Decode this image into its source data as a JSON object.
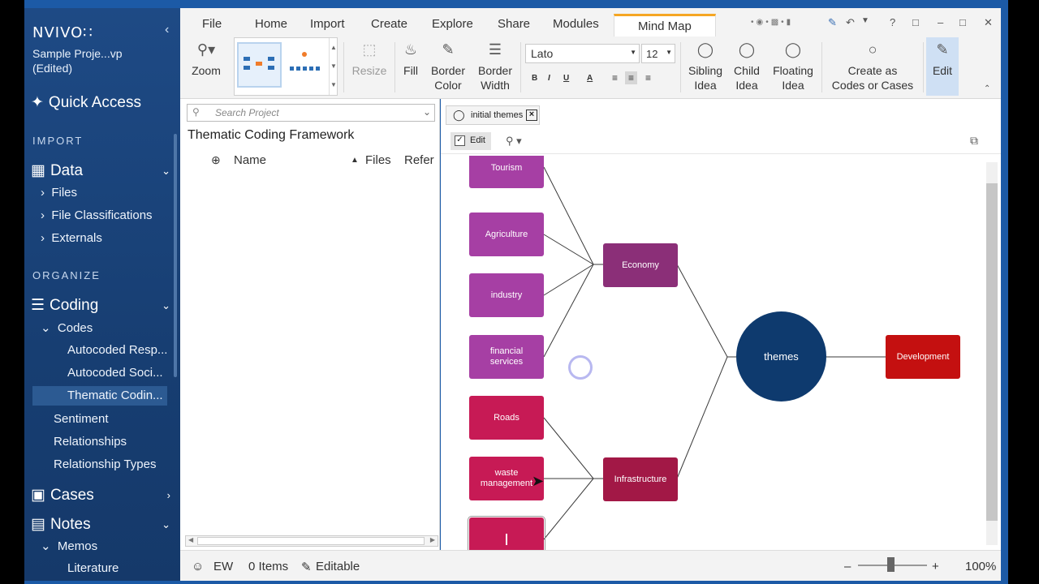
{
  "sidebar": {
    "logo": "NVIVO∷",
    "collapse": "‹",
    "project_line1": "Sample Proje...vp",
    "project_line2": "(Edited)",
    "quick_access": "Quick Access",
    "section_import": "IMPORT",
    "data": "Data",
    "files": "Files",
    "file_classifications": "File Classifications",
    "externals": "Externals",
    "section_organize": "ORGANIZE",
    "coding": "Coding",
    "codes": "Codes",
    "autocoded_resp": "Autocoded Resp...",
    "autocoded_soci": "Autocoded Soci...",
    "thematic_coding": "Thematic Codin...",
    "sentiment": "Sentiment",
    "relationships": "Relationships",
    "relationship_types": "Relationship Types",
    "cases": "Cases",
    "notes": "Notes",
    "memos": "Memos",
    "literature": "Literature"
  },
  "tabs": [
    "File",
    "Home",
    "Import",
    "Create",
    "Explore",
    "Share",
    "Modules",
    "Mind Map"
  ],
  "ribbon": {
    "zoom": "Zoom",
    "resize": "Resize",
    "fill": "Fill",
    "border_color_1": "Border",
    "border_color_2": "Color",
    "border_width_1": "Border",
    "border_width_2": "Width",
    "font": "Lato",
    "size": "12",
    "sibling_1": "Sibling",
    "sibling_2": "Idea",
    "child_1": "Child",
    "child_2": "Idea",
    "floating_1": "Floating",
    "floating_2": "Idea",
    "create_1": "Create as",
    "create_2": "Codes or Cases",
    "edit": "Edit"
  },
  "nav": {
    "search_placeholder": "Search Project",
    "title": "Thematic Coding Framework",
    "col_name": "Name",
    "col_files": "Files",
    "col_refs": "Refer"
  },
  "doc": {
    "tab_label": "initial themes",
    "edit_label": "Edit"
  },
  "mindmap": {
    "tourism": "Tourism",
    "agriculture": "Agriculture",
    "industry": "industry",
    "financial_1": "financial",
    "financial_2": "services",
    "roads": "Roads",
    "waste_1": "waste",
    "waste_2": "management",
    "economy": "Economy",
    "infrastructure": "Infrastructure",
    "themes": "themes",
    "development": "Development"
  },
  "status": {
    "user": "EW",
    "items": "0 Items",
    "editable": "Editable",
    "zoom": "100%"
  },
  "colors": {
    "purple_node": "#a63fa4",
    "economy": "#8b2f78",
    "pink_node": "#c71a55",
    "infrastructure": "#a21846",
    "themes": "#0e3a6e",
    "development": "#c41010"
  }
}
